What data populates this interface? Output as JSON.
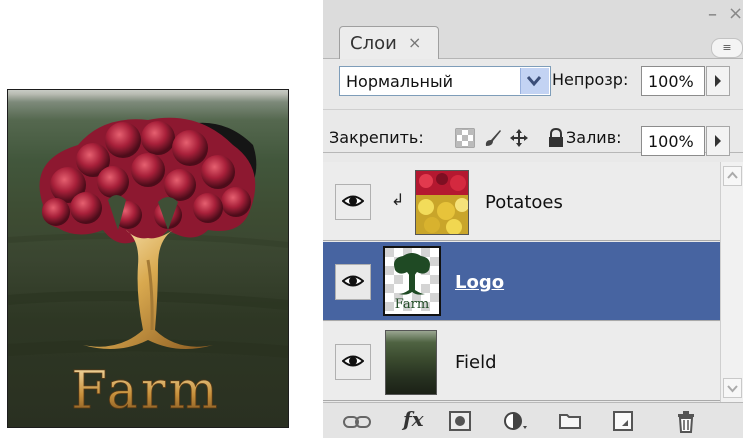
{
  "panel": {
    "tab_label": "Слои",
    "tab_close": "×",
    "window_minimize": "–",
    "window_close": "×",
    "menu_icon": "≡"
  },
  "blend_mode": {
    "value": "Нормальный",
    "opacity_label": "Непрозр:",
    "opacity_value": "100%"
  },
  "lock": {
    "label": "Закрепить:",
    "fill_label": "Залив:",
    "fill_value": "100%"
  },
  "layers": [
    {
      "name": "Potatoes",
      "visible": true,
      "clipped": true,
      "selected": false,
      "clip_icon": "↲"
    },
    {
      "name": "Logo",
      "visible": true,
      "clipped": false,
      "selected": true,
      "thumb_text": "Farm"
    },
    {
      "name": "Field",
      "visible": true,
      "clipped": false,
      "selected": false
    }
  ],
  "canvas": {
    "logo_text": "Farm"
  },
  "colors": {
    "selection": "#4764a1",
    "panel_bg": "#e9e9e9"
  },
  "icons": {
    "bottom_bar": [
      "link-layers-icon",
      "fx-icon",
      "add-mask-icon",
      "adjustment-layer-icon",
      "new-group-icon",
      "new-layer-icon",
      "delete-layer-icon"
    ],
    "fx_text": "fx"
  }
}
